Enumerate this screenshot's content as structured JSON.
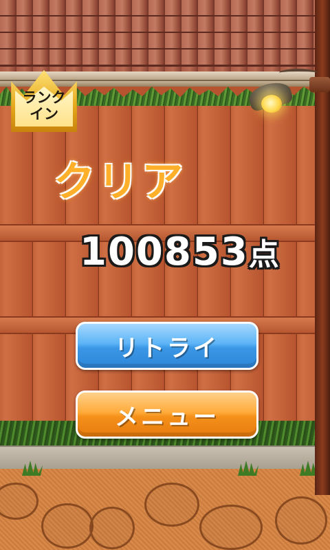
{
  "rank_badge": {
    "line1": "ランク",
    "line2": "イン"
  },
  "result": {
    "title": "クリア",
    "score": "100853",
    "score_unit": "点"
  },
  "buttons": {
    "retry_label": "リトライ",
    "menu_label": "メニュー"
  },
  "colors": {
    "retry_button": "#3a97e6",
    "menu_button": "#f5901a",
    "title_orange": "#ffb02a"
  }
}
